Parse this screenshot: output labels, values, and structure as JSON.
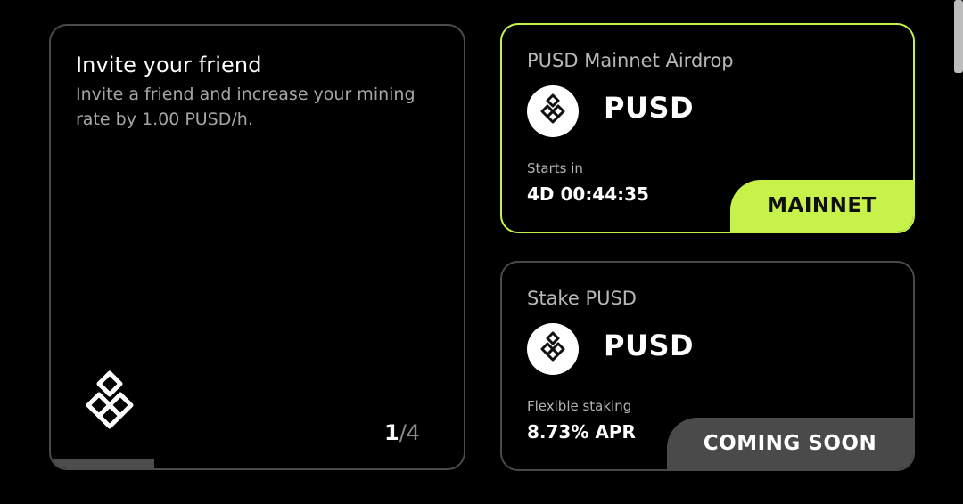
{
  "invite": {
    "title": "Invite your friend",
    "description": "Invite a friend and increase your mining rate by 1.00 PUSD/h.",
    "pager": {
      "current": "1",
      "separator": "/",
      "total": "4"
    },
    "progress_fraction": 0.25,
    "logo_icon": "pusd-diamond-logo-icon"
  },
  "airdrop": {
    "title": "PUSD Mainnet Airdrop",
    "token": "PUSD",
    "label": "Starts in",
    "value": "4D 00:44:35",
    "badge": "MAINNET"
  },
  "stake": {
    "title": "Stake PUSD",
    "token": "PUSD",
    "label": "Flexible staking",
    "value": "8.73% APR",
    "badge": "COMING SOON"
  },
  "colors": {
    "accent": "#c6f24a",
    "background": "#000000",
    "border": "#4a4a4a",
    "muted_text": "#a6a6a6"
  }
}
